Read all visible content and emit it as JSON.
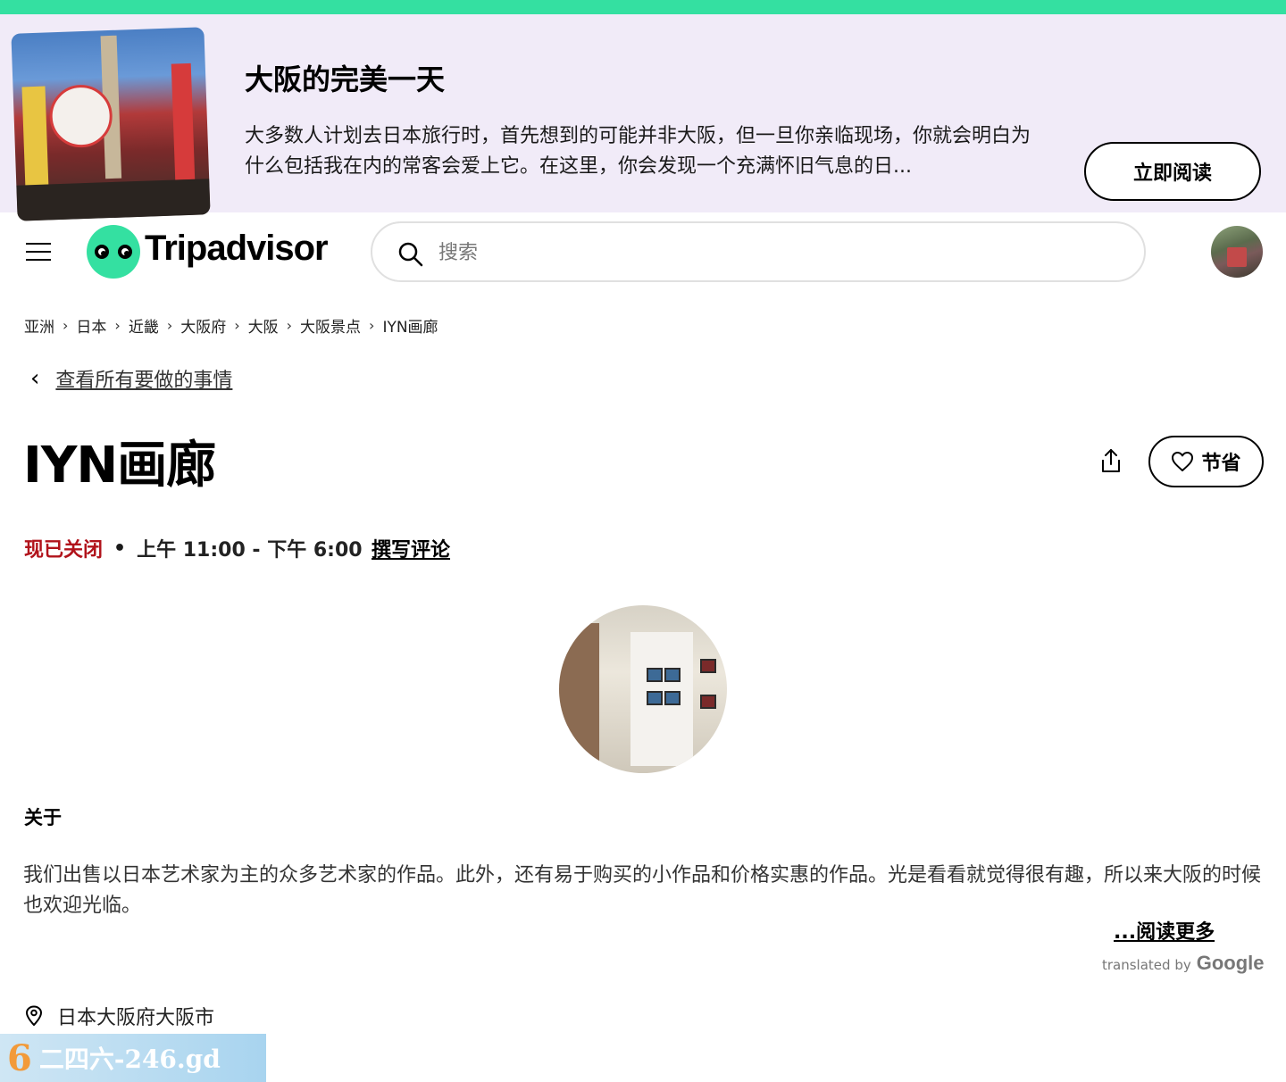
{
  "promo": {
    "title": "大阪的完美一天",
    "text": "大多数人计划去日本旅行时，首先想到的可能并非大阪，但一旦你亲临现场，你就会明白为什么包括我在内的常客会爱上它。在这里，你会发现一个充满怀旧气息的日...",
    "button": "立即阅读"
  },
  "header": {
    "logo_text": "Tripadvisor",
    "search_placeholder": "搜索"
  },
  "breadcrumb": [
    "亚洲",
    "日本",
    "近畿",
    "大阪府",
    "大阪",
    "大阪景点",
    "IYN画廊"
  ],
  "back_link": "查看所有要做的事情",
  "title": "IYN画廊",
  "save_label": "节省",
  "status": {
    "closed": "现已关闭",
    "dot": "•",
    "hours": "上午 11:00 - 下午 6:00",
    "write_review": "撰写评论"
  },
  "about": {
    "heading": "关于",
    "text": "我们出售以日本艺术家为主的众多艺术家的作品。此外，还有易于购买的小作品和价格实惠的作品。光是看看就觉得很有趣，所以来大阪的时候也欢迎光临。",
    "read_more": "...阅读更多",
    "translated_by": "translated by",
    "google": "Google"
  },
  "address": "日本大阪府大阪市",
  "watermark": {
    "logo": "6",
    "text": "二四六-246.gd"
  },
  "colors": {
    "brand_green": "#34e0a1",
    "promo_bg": "#f1ebf8",
    "closed_red": "#b1131b"
  }
}
